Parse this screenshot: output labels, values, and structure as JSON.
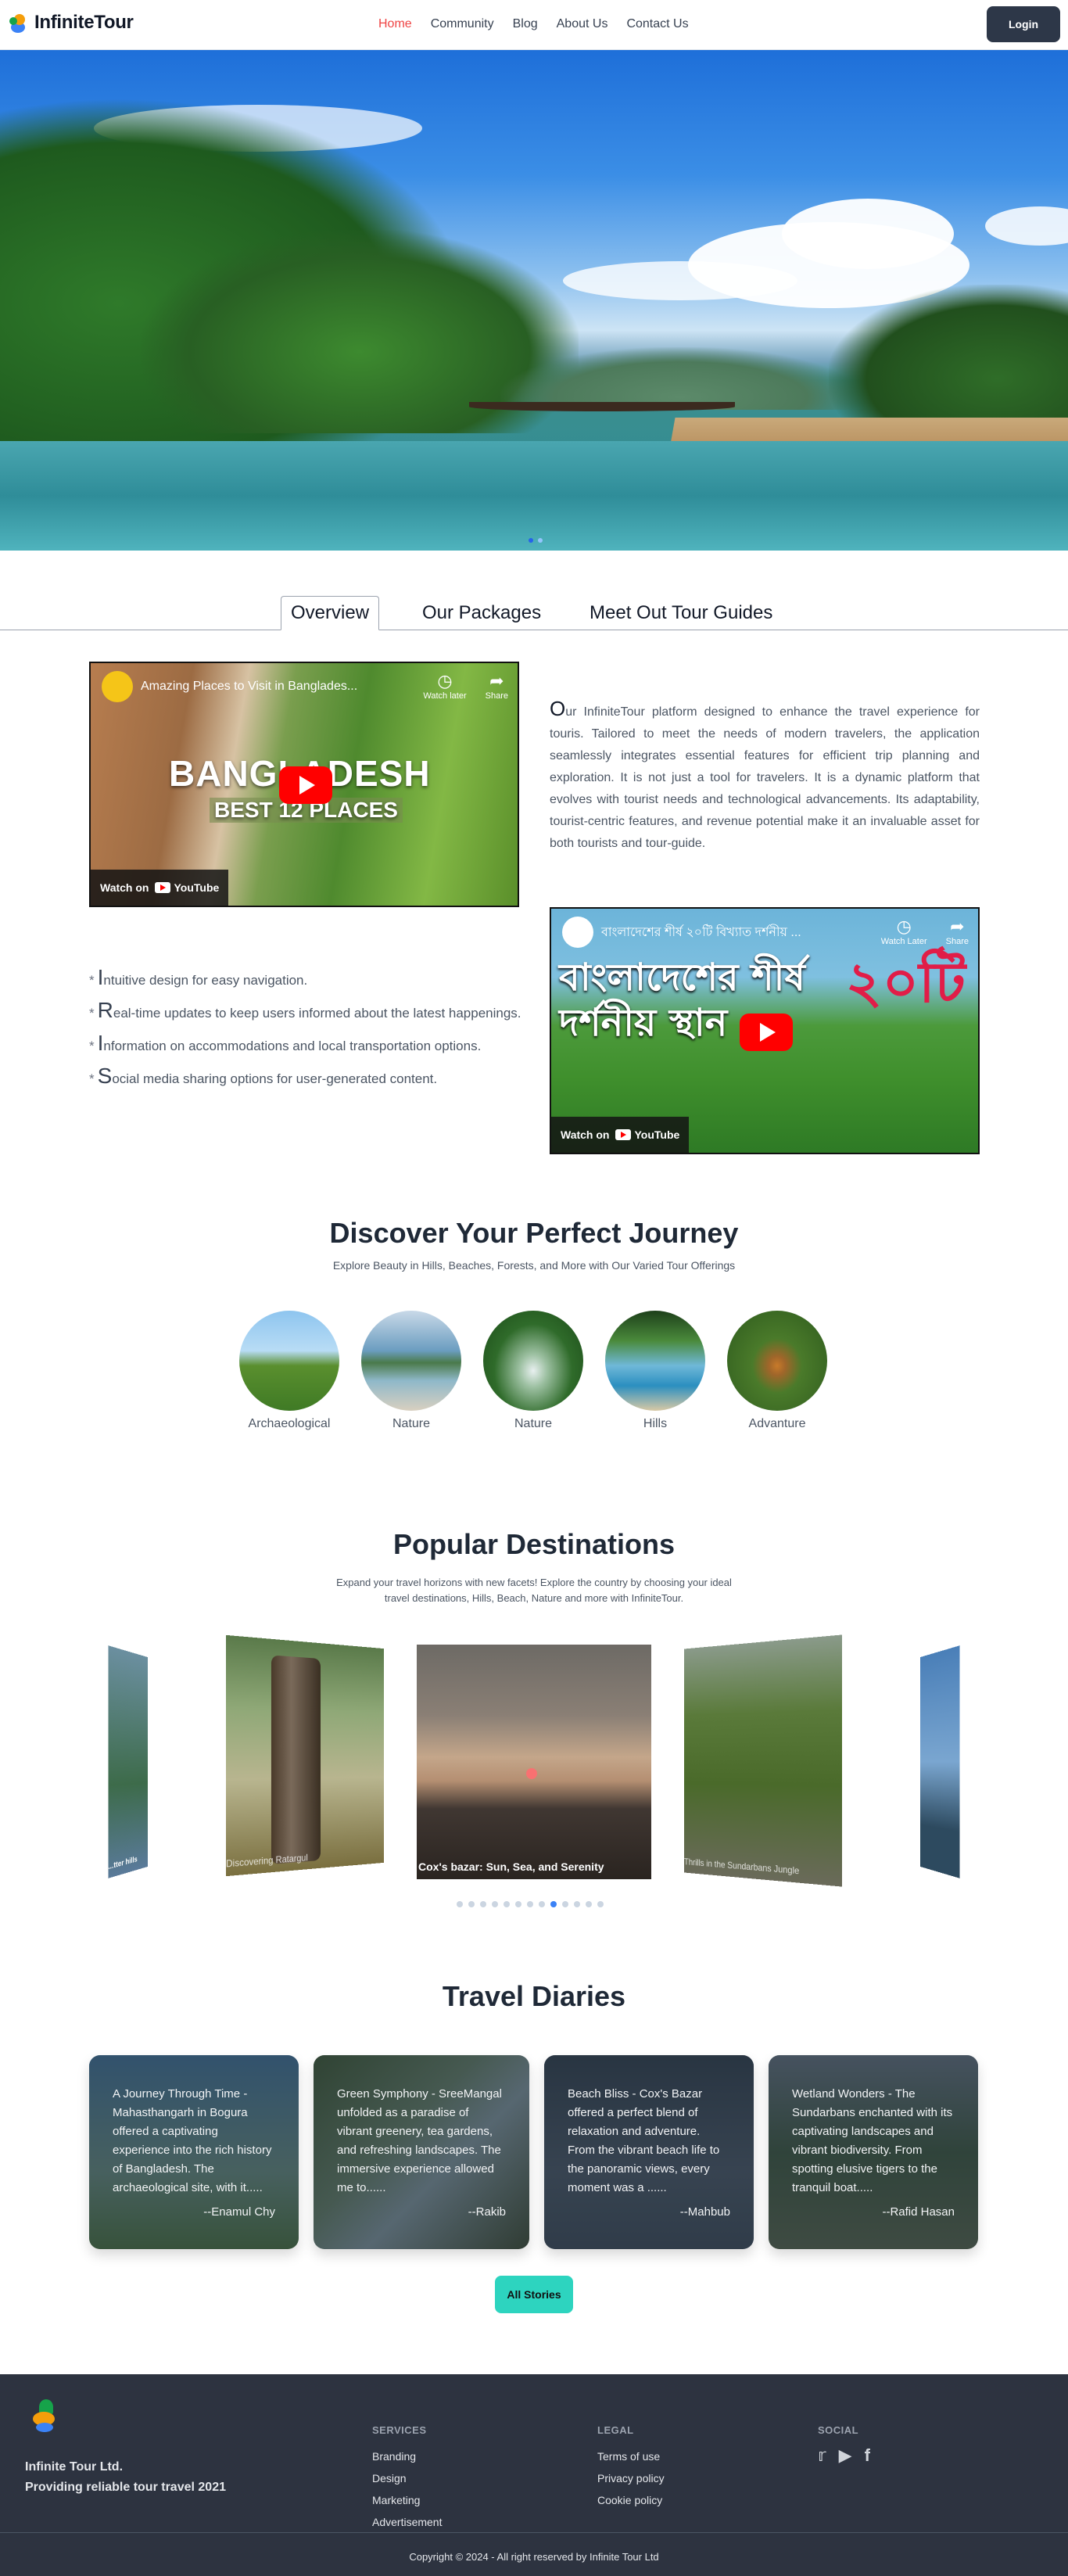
{
  "nav": {
    "brand": "InfiniteTour",
    "links": [
      "Home",
      "Community",
      "Blog",
      "About Us",
      "Contact Us"
    ],
    "login": "Login"
  },
  "tabs": [
    "Overview",
    "Our Packages",
    "Meet Out Tour Guides"
  ],
  "videos": [
    {
      "title": "Amazing Places to Visit in Banglades...",
      "overlay_title": "BANGLADESH",
      "overlay_sub": "BEST 12 PLACES",
      "watch_later": "Watch later",
      "share": "Share",
      "watch_on": "Watch on",
      "youtube": "YouTube"
    },
    {
      "title": "বাংলাদেশের শীর্ষ ২০টি বিখ্যাত দর্শনীয় ...",
      "overlay_line1": "বাংলাদেশের শীর্ষ",
      "overlay_line2": "দর্শনীয় স্থান",
      "overlay_num": "২০টি",
      "watch_later": "Watch Later",
      "share": "Share",
      "watch_on": "Watch on",
      "youtube": "YouTube"
    }
  ],
  "about": {
    "first_letter": "O",
    "text": "ur InfiniteTour platform designed to enhance the travel experience for touris. Tailored to meet the needs of modern travelers, the application seamlessly integrates essential features for efficient trip planning and exploration. It is not just a tool for travelers. It is a dynamic platform that evolves with tourist needs and technological advancements. Its adaptability, tourist-centric features, and revenue potential make it an invaluable asset for both tourists and tour-guide."
  },
  "features": [
    {
      "cap": "I",
      "text": "ntuitive design for easy navigation."
    },
    {
      "cap": "R",
      "text": "eal-time updates to keep users informed about the latest happenings."
    },
    {
      "cap": "I",
      "text": "nformation on accommodations and local transportation options."
    },
    {
      "cap": "S",
      "text": "ocial media sharing options for user-generated content."
    }
  ],
  "discover": {
    "title": "Discover Your Perfect Journey",
    "subtitle": "Explore Beauty in Hills, Beaches, Forests, and More with Our Varied Tour Offerings",
    "categories": [
      "Archaeological",
      "Nature",
      "Nature",
      "Hills",
      "Advanture"
    ]
  },
  "popular": {
    "title": "Popular Destinations",
    "subtitle_line1": "Expand your travel horizons with new facets! Explore the country by choosing your ideal",
    "subtitle_line2": "travel destinations, Hills, Beach, Nature and more with InfiniteTour.",
    "slides": [
      {
        "caption": "...tter hills"
      },
      {
        "caption": "Discovering Ratargul"
      },
      {
        "caption": "Cox's bazar: Sun, Sea, and Serenity"
      },
      {
        "caption": "Thrills in the Sundarbans Jungle"
      },
      {
        "caption": ""
      }
    ],
    "dot_count": 13,
    "active_dot": 8
  },
  "diaries": {
    "title": "Travel Diaries",
    "cards": [
      {
        "text": "A Journey Through Time - Mahasthangarh in Bogura offered a captivating experience into the rich history of Bangladesh. The archaeological site, with it.....",
        "author": "--Enamul Chy"
      },
      {
        "text": "Green Symphony - SreeMangal unfolded as a paradise of vibrant greenery, tea gardens, and refreshing landscapes. The immersive experience allowed me to......",
        "author": "--Rakib"
      },
      {
        "text": "Beach Bliss - Cox's Bazar offered a perfect blend of relaxation and adventure. From the vibrant beach life to the panoramic views, every moment was a ......",
        "author": "--Mahbub"
      },
      {
        "text": "Wetland Wonders - The Sundarbans enchanted with its captivating landscapes and vibrant biodiversity. From spotting elusive tigers to the tranquil boat.....",
        "author": "--Rafid Hasan"
      }
    ],
    "button": "All Stories"
  },
  "footer": {
    "company": "Infinite Tour Ltd.",
    "tagline": "Providing reliable tour travel 2021",
    "services_title": "SERVICES",
    "services": [
      "Branding",
      "Design",
      "Marketing",
      "Advertisement"
    ],
    "legal_title": "LEGAL",
    "legal": [
      "Terms of use",
      "Privacy policy",
      "Cookie policy"
    ],
    "social_title": "SOCIAL",
    "social_icons": [
      "twitter-icon",
      "youtube-icon",
      "facebook-icon"
    ],
    "copyright": "Copyright © 2024 - All right reserved by Infinite Tour Ltd"
  },
  "colors": {
    "accent_red": "#ef4444",
    "dark": "#2d3748",
    "teal_button": "#2dd4bf",
    "footer_bg": "#2d3340"
  }
}
